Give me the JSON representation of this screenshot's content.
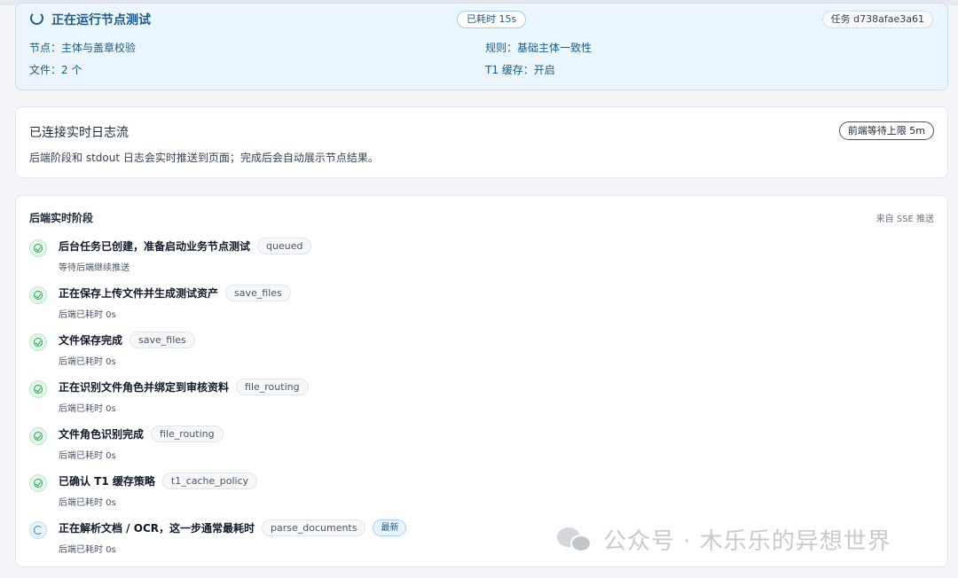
{
  "status": {
    "title": "正在运行节点测试",
    "elapsed": "已耗时 15s",
    "task": "任务 d738afae3a61",
    "node": "节点：主体与盖章校验",
    "rule": "规则：基础主体一致性",
    "files": "文件：2 个",
    "cache": "T1 缓存：开启"
  },
  "log": {
    "title": "已连接实时日志流",
    "limit": "前端等待上限 5m",
    "description": "后端阶段和 stdout 日志会实时推送到页面；完成后会自动展示节点结果。"
  },
  "stages": {
    "title": "后端实时阶段",
    "source": "来自 SSE 推送",
    "items": [
      {
        "title": "后台任务已创建，准备启动业务节点测试",
        "code": "queued",
        "sub": "等待后端继续推送",
        "state": "done"
      },
      {
        "title": "正在保存上传文件并生成测试资产",
        "code": "save_files",
        "sub": "后端已耗时 0s",
        "state": "done"
      },
      {
        "title": "文件保存完成",
        "code": "save_files",
        "sub": "后端已耗时 0s",
        "state": "done"
      },
      {
        "title": "正在识别文件角色并绑定到审核资料",
        "code": "file_routing",
        "sub": "后端已耗时 0s",
        "state": "done"
      },
      {
        "title": "文件角色识别完成",
        "code": "file_routing",
        "sub": "后端已耗时 0s",
        "state": "done"
      },
      {
        "title": "已确认 T1 缓存策略",
        "code": "t1_cache_policy",
        "sub": "后端已耗时 0s",
        "state": "done"
      },
      {
        "title": "正在解析文档 / OCR，这一步通常最耗时",
        "code": "parse_documents",
        "sub": "后端已耗时 0s",
        "state": "running",
        "badge": "最新"
      }
    ]
  },
  "watermark": {
    "text": "公众号 · 木乐乐的异想世界"
  }
}
